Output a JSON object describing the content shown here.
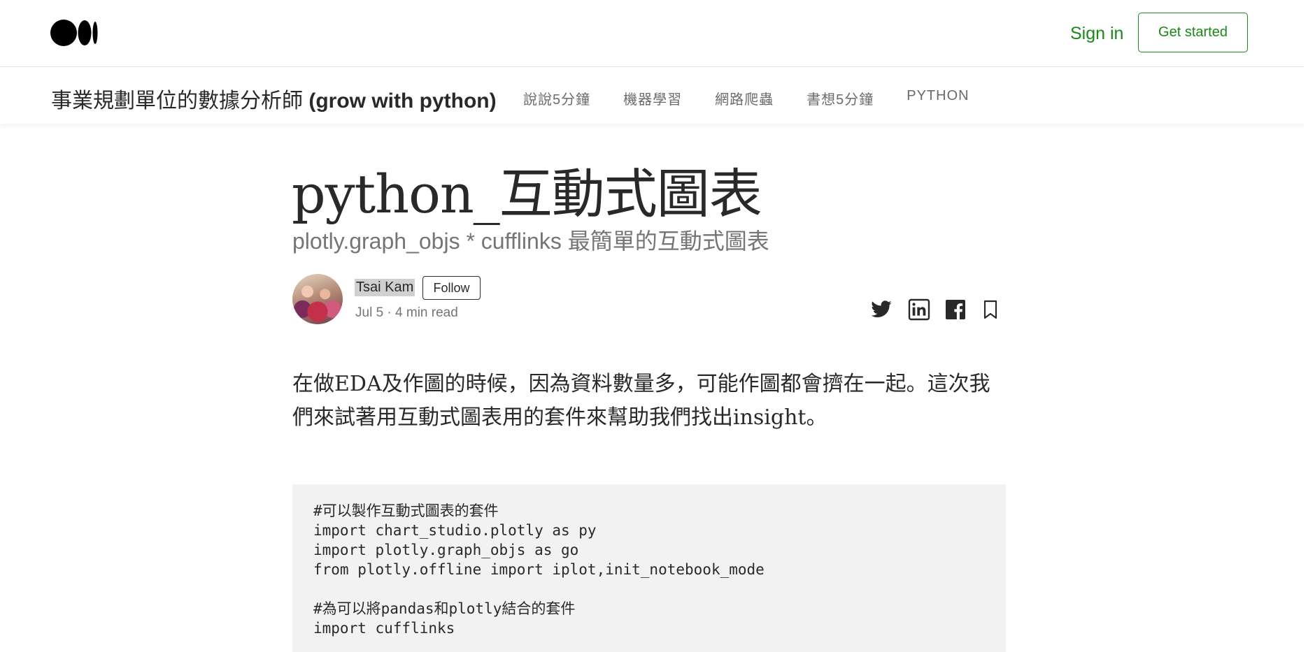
{
  "header": {
    "signin_label": "Sign in",
    "getstarted_label": "Get started"
  },
  "publication": {
    "name_cjk": "事業規劃單位的數據分析師 ",
    "name_latin": "(grow with python)",
    "nav": [
      "說說5分鐘",
      "機器學習",
      "網路爬蟲",
      "書想5分鐘",
      "PYTHON"
    ]
  },
  "article": {
    "title": "python_互動式圖表",
    "subtitle": "plotly.graph_objs * cufflinks 最簡單的互動式圖表",
    "author": "Tsai Kam",
    "follow_label": "Follow",
    "meta": "Jul 5 · 4 min read",
    "paragraph": "在做EDA及作圖的時候，因為資料數量多，可能作圖都會擠在一起。這次我們來試著用互動式圖表用的套件來幫助我們找出insight。",
    "code_block_1": [
      "#可以製作互動式圖表的套件",
      "import chart_studio.plotly as py",
      "import plotly.graph_objs as go",
      "from plotly.offline import iplot,init_notebook_mode"
    ],
    "code_block_2": [
      "#為可以將pandas和plotly結合的套件",
      "import cufflinks"
    ]
  },
  "icons": {
    "logo": "medium-logo",
    "share": [
      "twitter-icon",
      "linkedin-icon",
      "facebook-icon",
      "bookmark-icon"
    ]
  },
  "colors": {
    "accent": "#1a8917",
    "text": "#292929",
    "muted": "#757575",
    "code_bg": "#f2f2f2"
  }
}
